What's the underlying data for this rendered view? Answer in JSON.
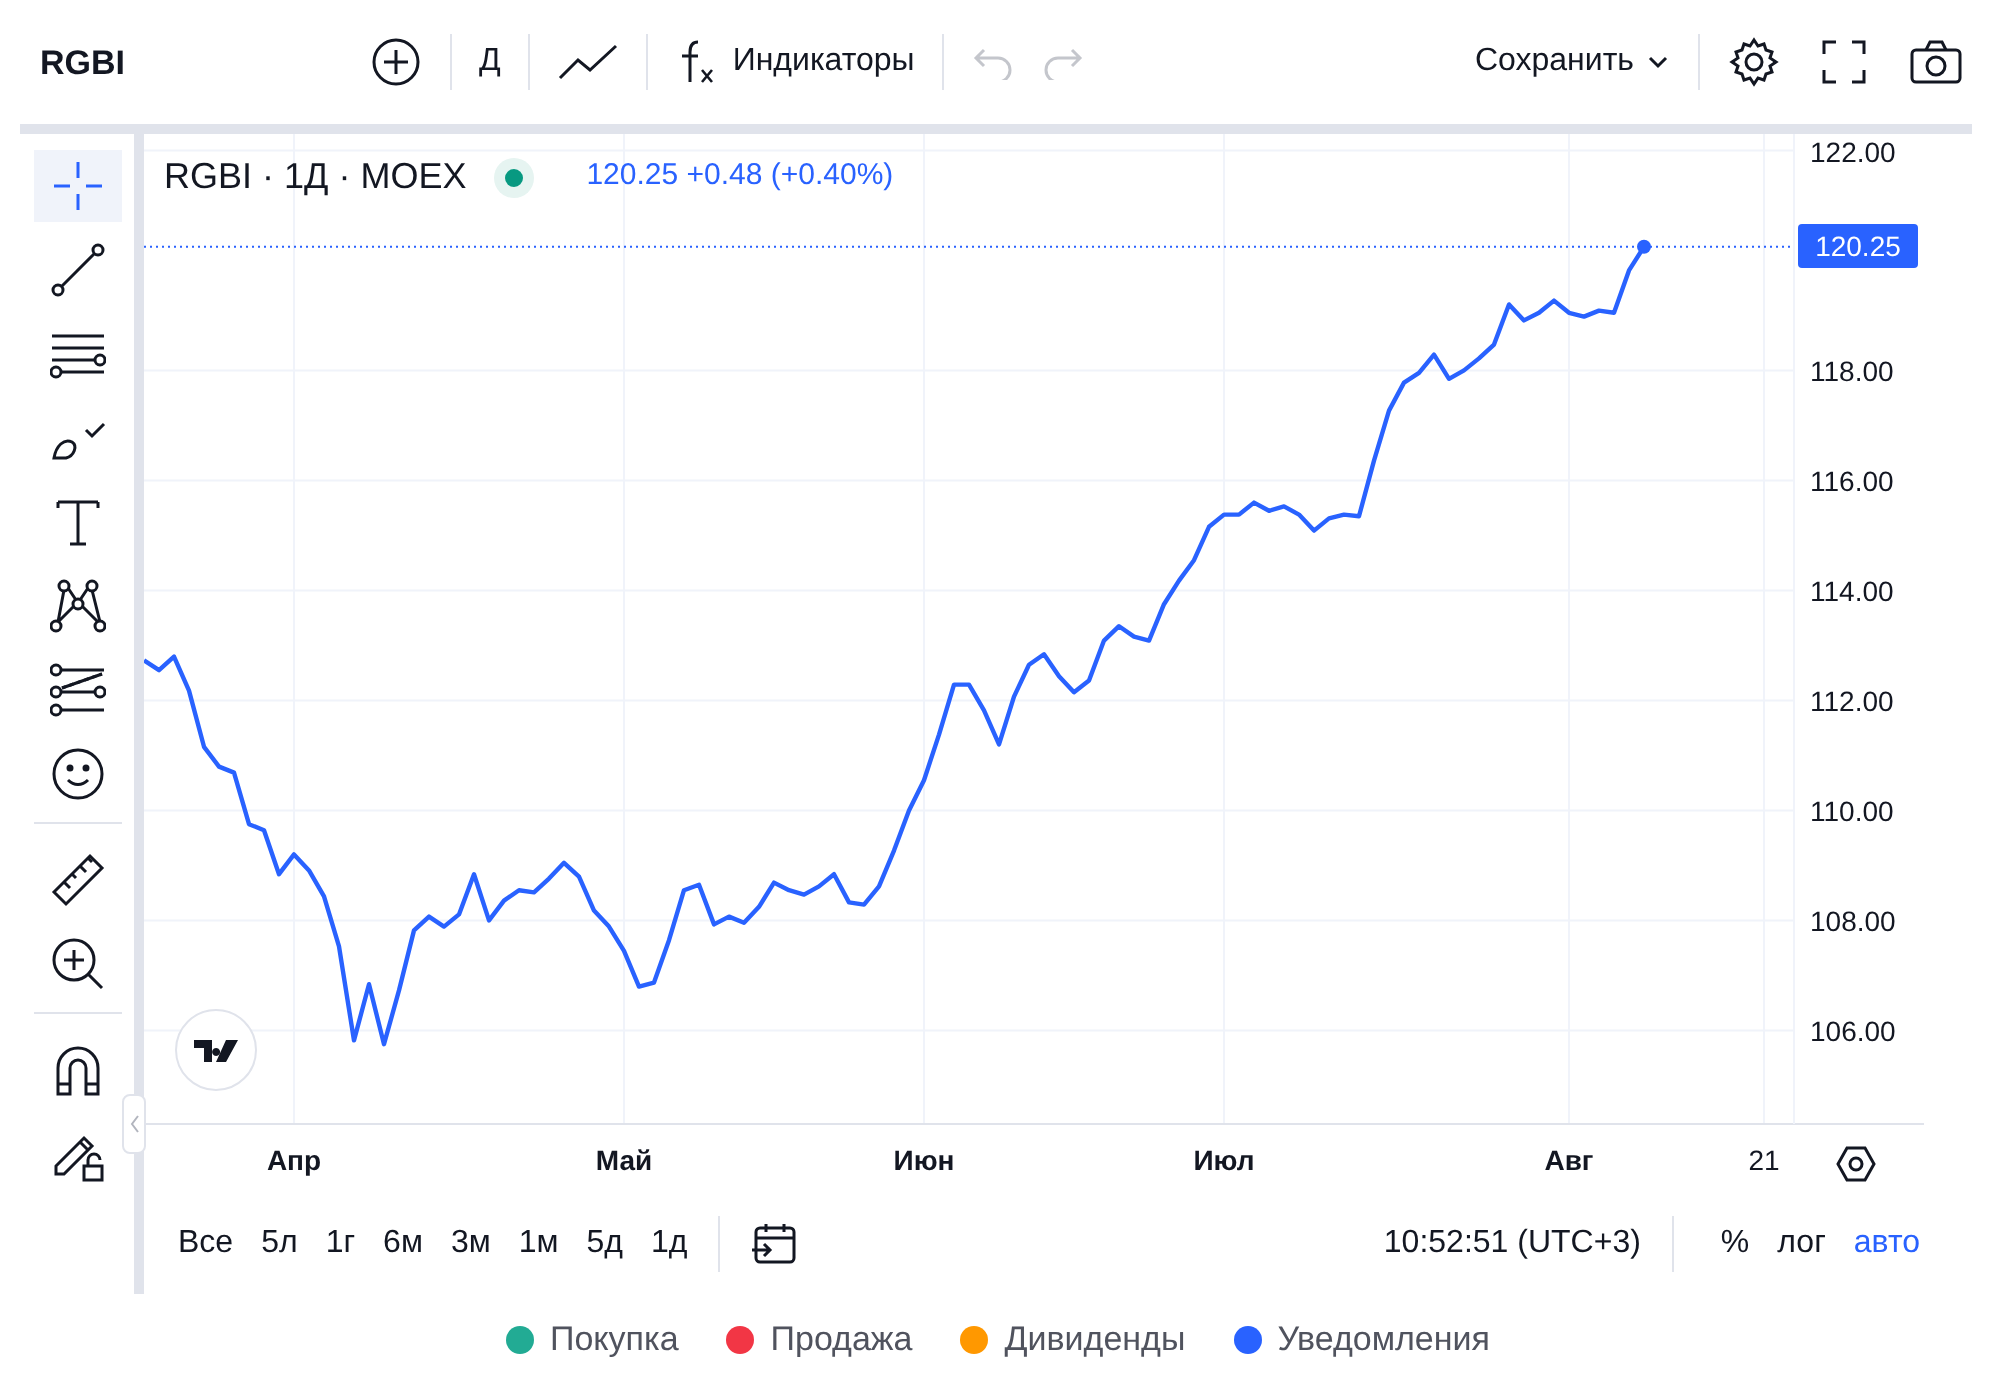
{
  "toolbar": {
    "symbol": "RGBI",
    "interval": "Д",
    "indicators": "Индикаторы",
    "undo_disabled": true,
    "redo_disabled": true,
    "save": "Сохранить"
  },
  "tools": [
    {
      "kind": "crosshair",
      "selected": true
    },
    {
      "kind": "trendline",
      "selected": false
    },
    {
      "kind": "hlines",
      "selected": false
    },
    {
      "kind": "brush",
      "selected": false
    },
    {
      "kind": "text",
      "selected": false
    },
    {
      "kind": "pattern",
      "selected": false
    },
    {
      "kind": "fib",
      "selected": false
    },
    {
      "kind": "smiley",
      "selected": false
    },
    {
      "kind": "divider"
    },
    {
      "kind": "ruler",
      "selected": false
    },
    {
      "kind": "zoom",
      "selected": false
    },
    {
      "kind": "divider"
    },
    {
      "kind": "magnet",
      "selected": false
    },
    {
      "kind": "lock",
      "selected": false
    }
  ],
  "chart": {
    "title": "RGBI · 1Д · MOEX",
    "quote": "120.25 +0.48 (+0.40%)",
    "last_price_label": "120.25",
    "chart_data": {
      "type": "line",
      "categories": [
        null,
        null,
        null,
        null,
        null,
        null,
        null,
        null,
        null,
        null,
        "Апр",
        null,
        null,
        null,
        null,
        null,
        null,
        null,
        null,
        null,
        null,
        null,
        null,
        null,
        null,
        null,
        null,
        null,
        null,
        null,
        null,
        null,
        "Май",
        null,
        null,
        null,
        null,
        null,
        null,
        null,
        null,
        null,
        null,
        null,
        null,
        null,
        null,
        null,
        null,
        null,
        null,
        null,
        "Июн",
        null,
        null,
        null,
        null,
        null,
        null,
        null,
        null,
        null,
        null,
        null,
        null,
        null,
        null,
        null,
        null,
        null,
        null,
        null,
        "Июл",
        null,
        null,
        null,
        null,
        null,
        null,
        null,
        null,
        null,
        null,
        null,
        null,
        null,
        null,
        null,
        null,
        null,
        null,
        null,
        null,
        null,
        null,
        "Авг",
        null,
        null,
        null,
        null,
        null,
        null,
        null,
        null,
        null,
        null,
        null,
        null,
        "21",
        null
      ],
      "series": [
        {
          "color": "#2962ff",
          "values": [
            112.73,
            112.55,
            112.8,
            112.18,
            111.16,
            110.8,
            110.69,
            109.75,
            109.64,
            108.84,
            109.2,
            108.91,
            108.44,
            107.53,
            105.82,
            106.84,
            105.75,
            106.73,
            107.82,
            108.07,
            107.89,
            108.11,
            108.84,
            108.0,
            108.36,
            108.55,
            108.51,
            108.76,
            109.05,
            108.8,
            108.18,
            107.89,
            107.45,
            106.8,
            106.87,
            107.64,
            108.55,
            108.65,
            107.93,
            108.07,
            107.96,
            108.25,
            108.69,
            108.55,
            108.47,
            108.62,
            108.84,
            108.33,
            108.29,
            108.62,
            109.27,
            110.0,
            110.55,
            111.38,
            112.29,
            112.29,
            111.82,
            111.2,
            112.07,
            112.65,
            112.84,
            112.44,
            112.15,
            112.36,
            113.09,
            113.35,
            113.16,
            113.09,
            113.75,
            114.18,
            114.55,
            115.16,
            115.38,
            115.38,
            115.6,
            115.45,
            115.53,
            115.38,
            115.09,
            115.31,
            115.38,
            115.35,
            116.36,
            117.27,
            117.78,
            117.96,
            118.29,
            117.85,
            118.0,
            118.22,
            118.47,
            119.2,
            118.91,
            119.05,
            119.27,
            119.05,
            118.98,
            119.09,
            119.05,
            119.82,
            120.25,
            null,
            null,
            null,
            null,
            null,
            null,
            null,
            null,
            null
          ]
        }
      ],
      "ylim": [
        104.3,
        122.3
      ],
      "grid": true,
      "ref_lines": [
        {
          "axis": "y",
          "value": 120.25
        }
      ],
      "yticks": [
        {
          "value": 106,
          "label": "106.00"
        },
        {
          "value": 108,
          "label": "108.00"
        },
        {
          "value": 110,
          "label": "110.00"
        },
        {
          "value": 112,
          "label": "112.00"
        },
        {
          "value": 114,
          "label": "114.00"
        },
        {
          "value": 116,
          "label": "116.00"
        },
        {
          "value": 118,
          "label": "118.00"
        },
        {
          "value": 122,
          "label": "122.00"
        }
      ]
    }
  },
  "ranges": [
    {
      "label": "Все"
    },
    {
      "label": "5л"
    },
    {
      "label": "1г"
    },
    {
      "label": "6м"
    },
    {
      "label": "3м"
    },
    {
      "label": "1м"
    },
    {
      "label": "5д"
    },
    {
      "label": "1д"
    }
  ],
  "clock": "10:52:51 (UTC+3)",
  "scale_modes": [
    {
      "label": "%",
      "selected": false
    },
    {
      "label": "лог",
      "selected": false
    },
    {
      "label": "авто",
      "selected": true
    }
  ],
  "legend": [
    {
      "label": "Покупка",
      "color": "#22ab94"
    },
    {
      "label": "Продажа",
      "color": "#f23645"
    },
    {
      "label": "Дивиденды",
      "color": "#ff9800"
    },
    {
      "label": "Уведомления",
      "color": "#2962ff"
    }
  ]
}
